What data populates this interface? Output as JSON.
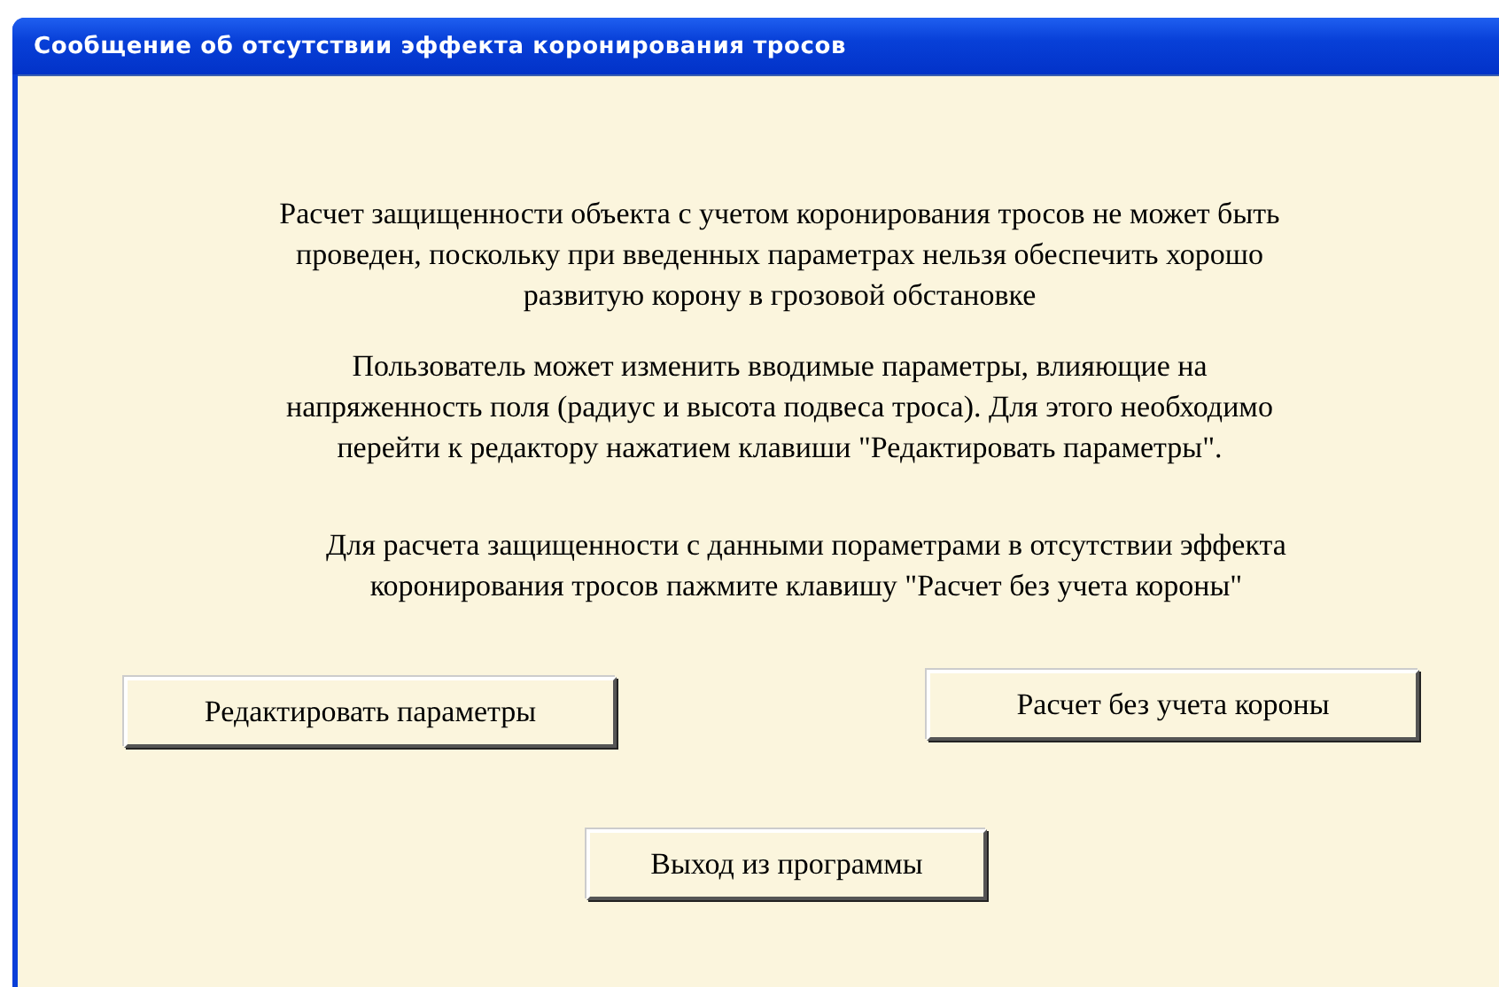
{
  "window": {
    "title": "Сообщение об отсутствии эффекта коронирования тросов"
  },
  "paragraphs": [
    "Расчет защищенности объекта с учетом коронирования тросов не может быть\nпроведен, поскольку при введенных параметрах нельзя обеспечить хорошо\nразвитую корону в грозовой обстановке",
    "Пользователь может изменить вводимые параметры, влияющие на\nнапряженность поля (радиус и высота подвеса троса). Для этого необходимо\nперейти к редактору нажатием клавиши \"Редактировать параметры\".",
    "Для расчета защищенности с данными пораметрами в отсутствии эффекта\nкоронирования тросов пажмите клавишу \"Расчет без учета короны\""
  ],
  "buttons": {
    "edit": "Редактировать параметры",
    "calculate": "Расчет без учета короны",
    "exit": "Выход из программы"
  }
}
